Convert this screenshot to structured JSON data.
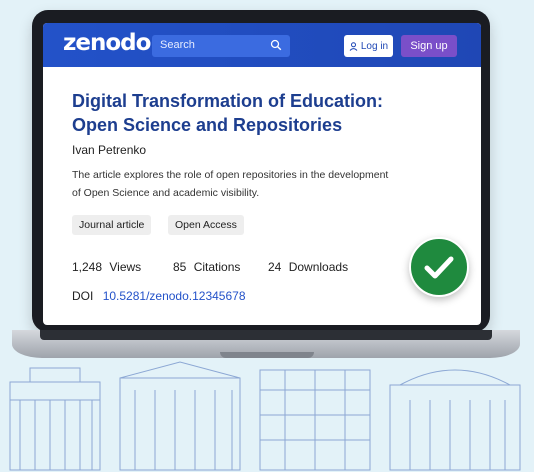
{
  "header": {
    "logo": "zenodo",
    "search_placeholder": "Search",
    "login_label": "Log in",
    "signup_label": "Sign up"
  },
  "record": {
    "title_line1": "Digital Transformation of Education:",
    "title_line2": "Open Science and Repositories",
    "author": "Ivan Petrenko",
    "abstract_line1": "The article explores the role of open repositories in the development",
    "abstract_line2": "of Open Science and academic visibility.",
    "tags": [
      "Journal article",
      "Open Access"
    ],
    "views": "1,248",
    "views_label": "Views",
    "citations": "85",
    "citations_label": "Citations",
    "downloads": "24",
    "downloads_label": "Downloads",
    "doi_label": "DOI",
    "doi": "10.5281/zenodo.12345678"
  },
  "colors": {
    "brand_blue": "#2352c9",
    "signup_purple": "#7a4fc9",
    "check_green": "#1f8a3e",
    "title_blue": "#1d3e8f"
  },
  "icons": [
    "search-icon",
    "user-icon",
    "check-icon"
  ]
}
